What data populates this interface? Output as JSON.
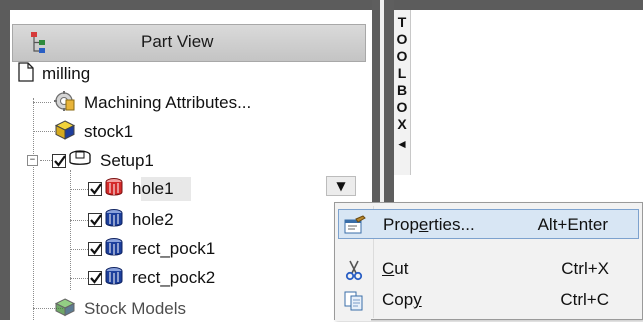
{
  "panel": {
    "title": "Part View"
  },
  "tree": {
    "root": {
      "label": "milling",
      "icon": "document-icon"
    },
    "items": [
      {
        "label": "Machining Attributes...",
        "icon": "machining-attributes-icon"
      },
      {
        "label": "stock1",
        "icon": "stock-cube-icon"
      },
      {
        "label": "Setup1",
        "icon": "setup-icon",
        "checked": true,
        "expanded": true
      },
      {
        "label": "hole1",
        "icon": "hole-feature-icon",
        "checked": true,
        "selected": true
      },
      {
        "label": "hole2",
        "icon": "hole-feature-icon",
        "checked": true
      },
      {
        "label": "rect_pock1",
        "icon": "pocket-feature-icon",
        "checked": true
      },
      {
        "label": "rect_pock2",
        "icon": "pocket-feature-icon",
        "checked": true
      },
      {
        "label": "Stock Models",
        "icon": "stock-models-icon"
      }
    ],
    "expander_symbol": "−"
  },
  "dropdown": {
    "symbol": "▼"
  },
  "toolbox": {
    "letters": [
      "T",
      "O",
      "O",
      "L",
      "B",
      "O",
      "X"
    ],
    "arrow": "◄"
  },
  "context_menu": {
    "items": [
      {
        "pre": "Prop",
        "accel": "e",
        "post": "rties...",
        "shortcut": "Alt+Enter",
        "icon": "properties-icon",
        "highlighted": true
      },
      {
        "pre": "",
        "accel": "C",
        "post": "ut",
        "shortcut": "Ctrl+X",
        "icon": "scissors-icon"
      },
      {
        "pre": "Cop",
        "accel": "y",
        "post": "",
        "shortcut": "Ctrl+C",
        "icon": "copy-icon"
      }
    ]
  },
  "colors": {
    "frame": "#5c5c5c",
    "menu_highlight": "#d8e6f4",
    "menu_highlight_border": "#7da2ce",
    "hole_selected": "#d42a2a",
    "feature_blue": "#1c3f9c"
  }
}
